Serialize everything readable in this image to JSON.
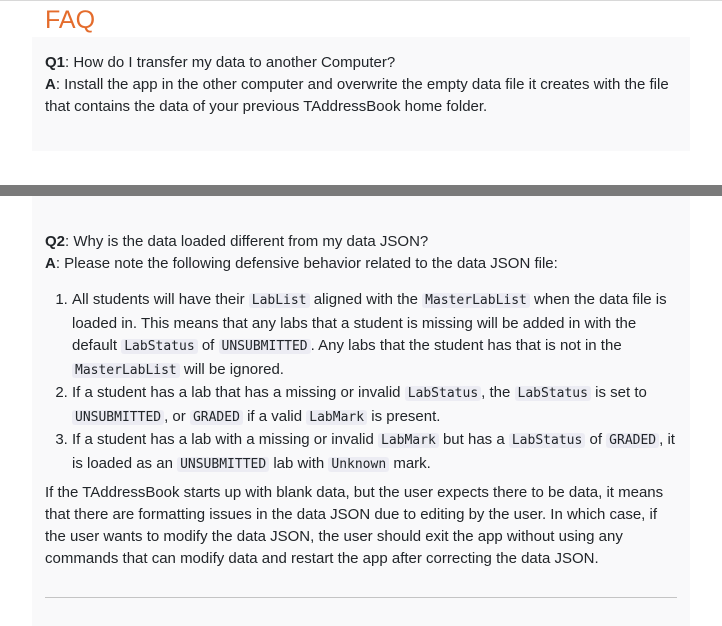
{
  "header": {
    "title": "FAQ"
  },
  "q1": {
    "q_label": "Q1",
    "question": ": How do I transfer my data to another Computer?",
    "a_label": "A",
    "answer": ": Install the app in the other computer and overwrite the empty data file it creates with the file that contains the data of your previous TAddressBook home folder."
  },
  "q2": {
    "q_label": "Q2",
    "question": ": Why is the data loaded different from my data JSON?",
    "a_label": "A",
    "answer": ": Please note the following defensive behavior related to the data JSON file:",
    "item1": {
      "t1": "All students will have their ",
      "c1": "LabList",
      "t2": " aligned with the ",
      "c2": "MasterLabList",
      "t3": " when the data file is loaded in. This means that any labs that a student is missing will be added in with the default ",
      "c3": "LabStatus",
      "t4": " of ",
      "c4": "UNSUBMITTED",
      "t5": ". Any labs that the student has that is not in the ",
      "c5": "MasterLabList",
      "t6": " will be ignored."
    },
    "item2": {
      "t1": "If a student has a lab that has a missing or invalid ",
      "c1": "LabStatus",
      "t2": ", the ",
      "c2": "LabStatus",
      "t3": " is set to ",
      "c3": "UNSUBMITTED",
      "t4": ", or ",
      "c4": "GRADED",
      "t5": " if a valid ",
      "c5": "LabMark",
      "t6": " is present."
    },
    "item3": {
      "t1": "If a student has a lab with a missing or invalid ",
      "c1": "LabMark",
      "t2": " but has a ",
      "c2": "LabStatus",
      "t3": " of ",
      "c3": "GRADED",
      "t4": ", it is loaded as an ",
      "c4": "UNSUBMITTED",
      "t5": " lab with ",
      "c5": "Unknown",
      "t6": " mark."
    },
    "closing": "If the TAddressBook starts up with blank data, but the user expects there to be data, it means that there are formatting issues in the data JSON due to editing by the user. In which case, if the user wants to modify the data JSON, the user should exit the app without using any commands that can modify data and restart the app after correcting the data JSON."
  },
  "colors": {
    "title": "#e46c2c",
    "panel": "#f9f9fa",
    "code_bg": "#ececf3",
    "divider": "#7a7a7a"
  }
}
